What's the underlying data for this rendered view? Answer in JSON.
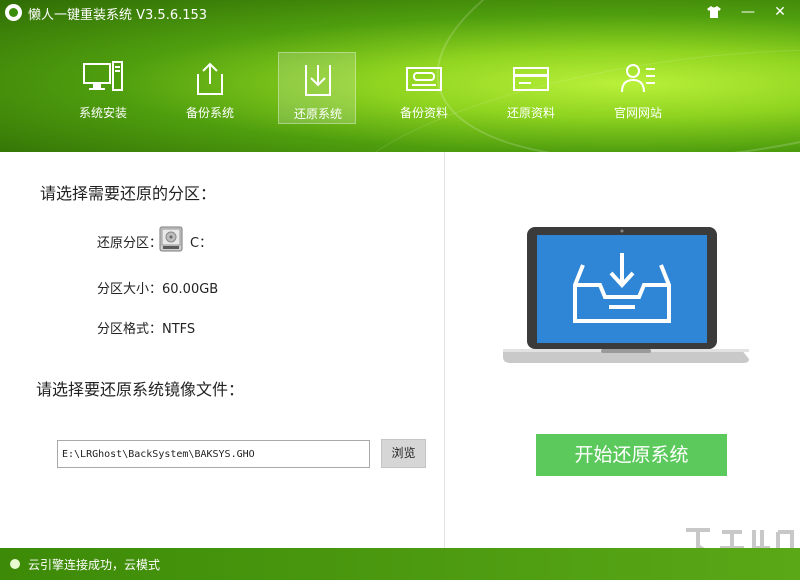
{
  "app": {
    "title": "懒人一键重装系统 V3.5.6.153"
  },
  "window_controls": {
    "skin": "skin-icon",
    "minimize": "—",
    "close": "✕"
  },
  "nav": {
    "items": [
      {
        "label": "系统安装",
        "icon": "monitor-pc-icon"
      },
      {
        "label": "备份系统",
        "icon": "upload-icon"
      },
      {
        "label": "还原系统",
        "icon": "download-icon",
        "active": true
      },
      {
        "label": "备份资料",
        "icon": "drive-box-icon"
      },
      {
        "label": "还原资料",
        "icon": "card-icon"
      },
      {
        "label": "官网网站",
        "icon": "person-list-icon"
      }
    ]
  },
  "left_panel": {
    "select_partition_title": "请选择需要还原的分区：",
    "restore_partition_label": "还原分区：",
    "restore_partition_value": "C：",
    "partition_size": "分区大小：60.00GB",
    "partition_format": "分区格式：NTFS",
    "select_image_title": "请选择要还原系统镜像文件：",
    "image_path_value": "E:\\LRGhost\\BackSystem\\BAKSYS.GHO",
    "browse_label": "浏览"
  },
  "right_panel": {
    "start_button_label": "开始还原系统"
  },
  "status_bar": {
    "text": "云引擎连接成功，云模式"
  },
  "colors": {
    "header_green": "#4f9e0e",
    "accent_green": "#5cc95c",
    "screen_blue": "#2f86d6"
  }
}
